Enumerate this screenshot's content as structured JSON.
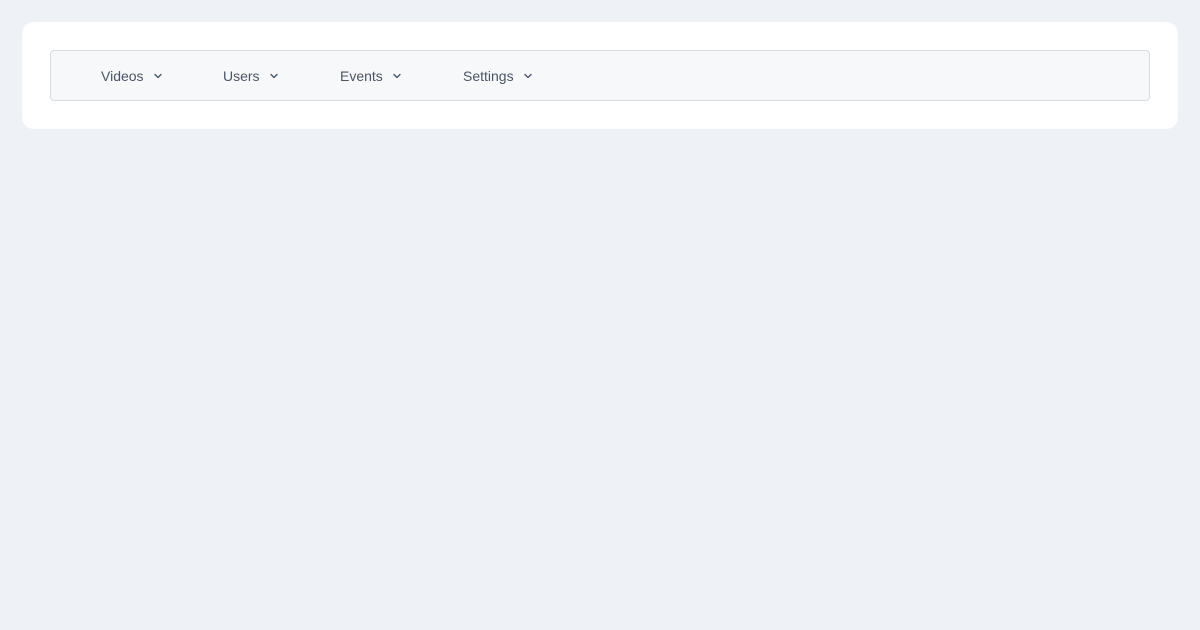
{
  "menu": {
    "items": [
      {
        "label": "Videos",
        "icon": "chevron-down-icon"
      },
      {
        "label": "Users",
        "icon": "chevron-down-icon"
      },
      {
        "label": "Events",
        "icon": "chevron-down-icon"
      },
      {
        "label": "Settings",
        "icon": "chevron-down-icon"
      }
    ]
  },
  "colors": {
    "page_background": "#eef1f6",
    "card_background": "#ffffff",
    "menubar_background": "#f7f8fa",
    "menubar_border": "#d9dce1",
    "text": "#4b5563"
  }
}
